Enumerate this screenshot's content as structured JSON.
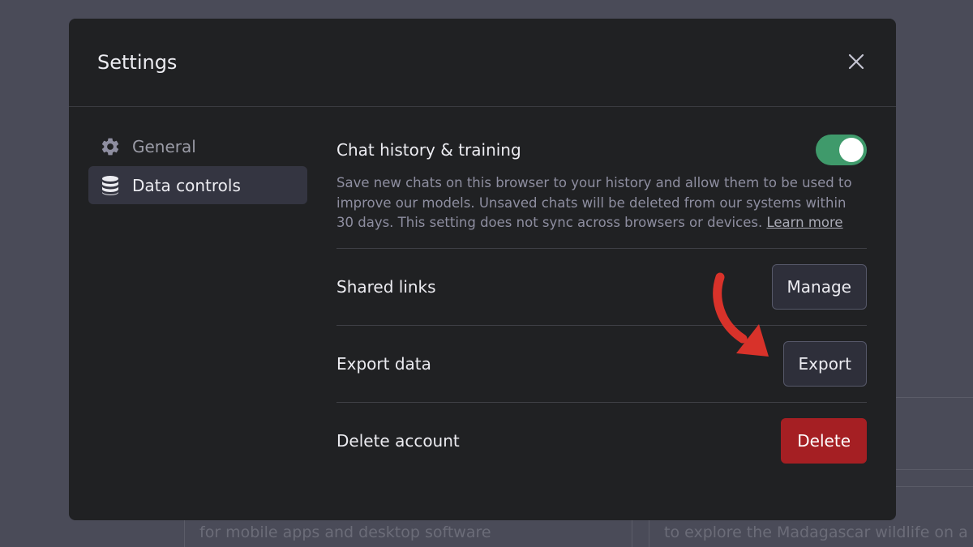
{
  "background": {
    "left_text": "for mobile apps and desktop software",
    "right_text": "to explore the Madagascar wildlife on a b"
  },
  "modal": {
    "title": "Settings",
    "close_icon": "close-icon"
  },
  "sidebar": {
    "items": [
      {
        "label": "General",
        "icon": "gear-icon",
        "active": false
      },
      {
        "label": "Data controls",
        "icon": "database-icon",
        "active": true
      }
    ]
  },
  "data_controls": {
    "chat_history": {
      "label": "Chat history & training",
      "enabled": true,
      "description": "Save new chats on this browser to your history and allow them to be used to improve our models. Unsaved chats will be deleted from our systems within 30 days. This setting does not sync across browsers or devices.",
      "learn_more": "Learn more"
    },
    "shared_links": {
      "label": "Shared links",
      "button": "Manage"
    },
    "export_data": {
      "label": "Export data",
      "button": "Export"
    },
    "delete_account": {
      "label": "Delete account",
      "button": "Delete"
    }
  },
  "colors": {
    "toggle_on": "#3f9a6b",
    "danger": "#a51f23",
    "annotation_arrow": "#d8322a"
  }
}
